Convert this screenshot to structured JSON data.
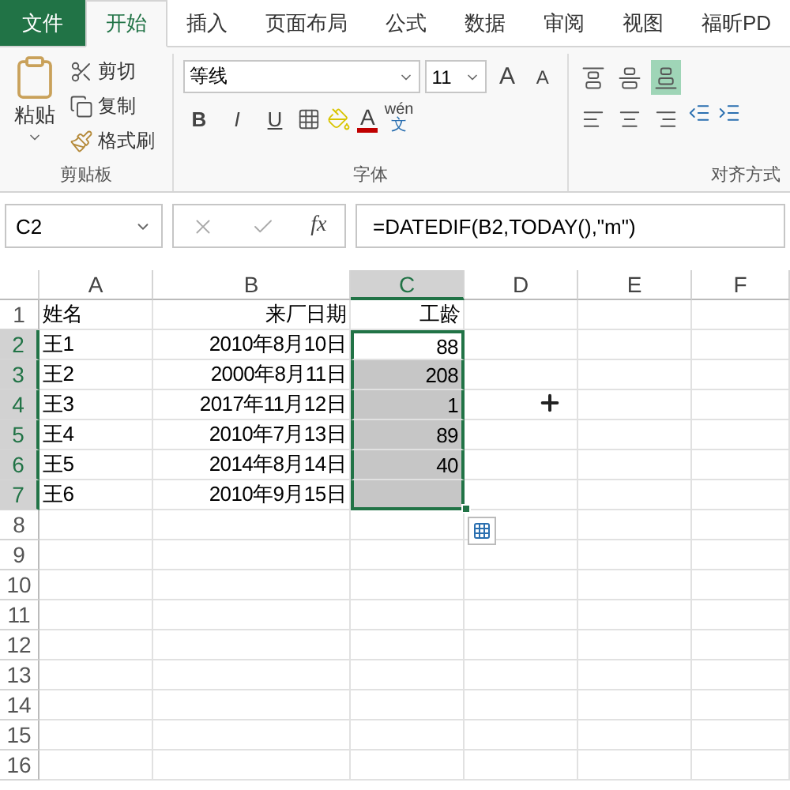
{
  "tabs": [
    {
      "label": "文件",
      "kind": "file",
      "selected": false
    },
    {
      "label": "开始",
      "kind": "tab",
      "selected": true
    },
    {
      "label": "插入",
      "kind": "tab",
      "selected": false
    },
    {
      "label": "页面布局",
      "kind": "tab",
      "selected": false
    },
    {
      "label": "公式",
      "kind": "tab",
      "selected": false
    },
    {
      "label": "数据",
      "kind": "tab",
      "selected": false
    },
    {
      "label": "审阅",
      "kind": "tab",
      "selected": false
    },
    {
      "label": "视图",
      "kind": "tab",
      "selected": false
    },
    {
      "label": "福昕PD",
      "kind": "tab",
      "selected": false
    }
  ],
  "clipboard": {
    "paste": "粘贴",
    "cut": "剪切",
    "copy": "复制",
    "format_painter": "格式刷",
    "label": "剪贴板"
  },
  "font": {
    "name": "等线",
    "size": "11",
    "grow": "A",
    "shrink": "A",
    "bold": "B",
    "italic": "I",
    "underline": "U",
    "font_color": "A",
    "phonetic_top": "wén",
    "phonetic_bottom": "文",
    "label": "字体"
  },
  "alignment": {
    "label": "对齐方式",
    "vertical": [
      {
        "kind": "top",
        "selected": false
      },
      {
        "kind": "middle",
        "selected": false
      },
      {
        "kind": "bottom",
        "selected": true
      }
    ],
    "horizontal": [
      {
        "kind": "left",
        "selected": false
      },
      {
        "kind": "center",
        "selected": false
      },
      {
        "kind": "right",
        "selected": false
      }
    ]
  },
  "formula_bar": {
    "name_box": "C2",
    "fx": "fx",
    "formula": "=DATEDIF(B2,TODAY(),\"m\")"
  },
  "columns": [
    {
      "label": "A",
      "selected": false
    },
    {
      "label": "B",
      "selected": false
    },
    {
      "label": "C",
      "selected": true
    },
    {
      "label": "D",
      "selected": false
    },
    {
      "label": "E",
      "selected": false
    },
    {
      "label": "F",
      "selected": false
    }
  ],
  "rows": [
    {
      "header": "1",
      "selected": false,
      "a": "姓名",
      "b": "来厂日期",
      "c": "工龄"
    },
    {
      "header": "2",
      "selected": true,
      "a": "王1",
      "b": "2010年8月10日",
      "c": "88"
    },
    {
      "header": "3",
      "selected": true,
      "a": "王2",
      "b": "2000年8月11日",
      "c": "208"
    },
    {
      "header": "4",
      "selected": true,
      "a": "王3",
      "b": "2017年11月12日",
      "c": "1"
    },
    {
      "header": "5",
      "selected": true,
      "a": "王4",
      "b": "2010年7月13日",
      "c": "89"
    },
    {
      "header": "6",
      "selected": true,
      "a": "王5",
      "b": "2014年8月14日",
      "c": "40"
    },
    {
      "header": "7",
      "selected": true,
      "a": "王6",
      "b": "2010年9月15日"
    },
    {
      "header": "8",
      "selected": false
    },
    {
      "header": "9",
      "selected": false
    },
    {
      "header": "10",
      "selected": false
    },
    {
      "header": "11",
      "selected": false
    },
    {
      "header": "12",
      "selected": false
    },
    {
      "header": "13",
      "selected": false
    },
    {
      "header": "14",
      "selected": false
    },
    {
      "header": "15",
      "selected": false
    },
    {
      "header": "16",
      "selected": false
    }
  ]
}
